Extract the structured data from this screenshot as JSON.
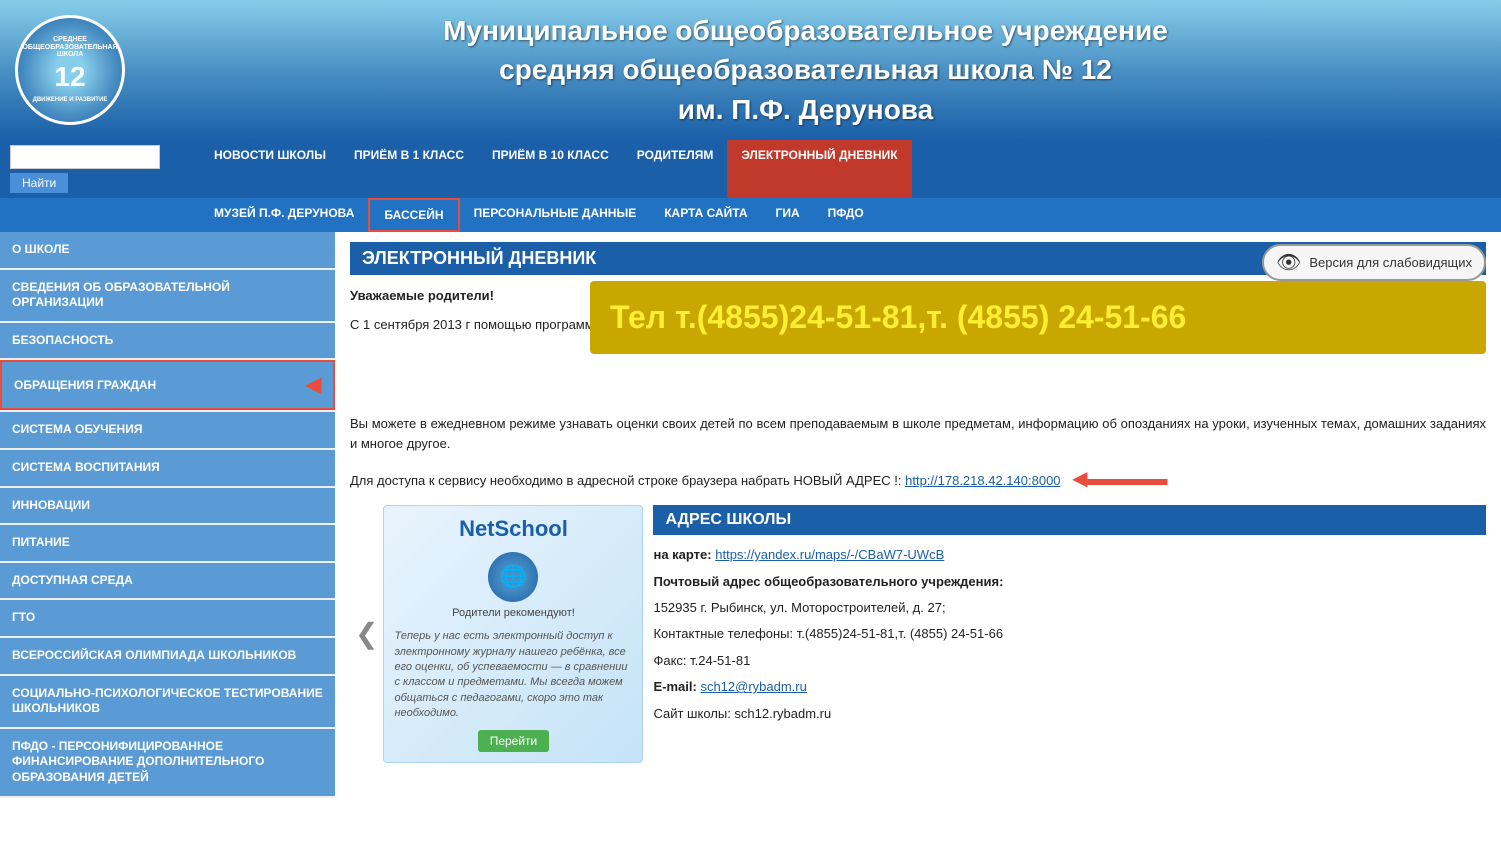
{
  "header": {
    "title_line1": "Муниципальное общеобразовательное  учреждение",
    "title_line2": "средняя общеобразовательная школа № 12",
    "title_line3": "им. П.Ф. Дерунова",
    "logo_number": "12"
  },
  "nav": {
    "search_placeholder": "",
    "search_btn": "Найти",
    "row1": [
      {
        "label": "НОВОСТИ ШКОЛЫ",
        "active": false
      },
      {
        "label": "ПРИЁМ В 1 КЛАСС",
        "active": false
      },
      {
        "label": "ПРИЁМ В 10 КЛАСС",
        "active": false
      },
      {
        "label": "РОДИТЕЛЯМ",
        "active": false
      },
      {
        "label": "ЭЛЕКТРОННЫЙ ДНЕВНИК",
        "active": true
      }
    ],
    "row2": [
      {
        "label": "МУЗЕЙ П.Ф. ДЕРУНОВА",
        "active": false
      },
      {
        "label": "БАССЕЙН",
        "active": false,
        "boxed": true
      },
      {
        "label": "ПЕРСОНАЛЬНЫЕ ДАННЫЕ",
        "active": false
      },
      {
        "label": "КАРТА САЙТА",
        "active": false
      },
      {
        "label": "ГИА",
        "active": false
      },
      {
        "label": "ПФДО",
        "active": false
      }
    ]
  },
  "sidebar": {
    "items": [
      {
        "label": "О ШКОЛЕ"
      },
      {
        "label": "СВЕДЕНИЯ ОБ ОБРАЗОВАТЕЛЬНОЙ ОРГАНИЗАЦИИ"
      },
      {
        "label": "БЕЗОПАСНОСТЬ"
      },
      {
        "label": "ОБРАЩЕНИЯ ГРАЖДАН",
        "active": true
      },
      {
        "label": "СИСТЕМА ОБУЧЕНИЯ"
      },
      {
        "label": "СИСТЕМА ВОСПИТАНИЯ"
      },
      {
        "label": "ИННОВАЦИИ"
      },
      {
        "label": "ПИТАНИЕ"
      },
      {
        "label": "ДОСТУПНАЯ СРЕДА"
      },
      {
        "label": "ГТО"
      },
      {
        "label": "ВСЕРОССИЙСКАЯ ОЛИМПИАДА ШКОЛЬНИКОВ"
      },
      {
        "label": "СОЦИАЛЬНО-ПСИХОЛОГИЧЕСКОЕ ТЕСТИРОВАНИЕ ШКОЛЬНИКОВ"
      },
      {
        "label": "ПФДО - ПЕРСОНИФИЦИРОВАННОЕ ФИНАНСИРОВАНИЕ ДОПОЛНИТЕЛЬНОГО ОБРАЗОВАНИЯ ДЕТЕЙ"
      }
    ]
  },
  "content": {
    "section_title": "ЭЛЕКТРОННЫЙ ДНЕВНИК",
    "vision_btn": "Версия для слабовидящих",
    "phone_banner": "Тел т.(4855)24-51-81,т. (4855) 24-51-66",
    "para1": "Уважаемые родители!",
    "para2_start": "С 1 сентября 2013 г",
    "para2_rest": "помощью программы",
    "para3": "Вы можете в ежедневном режиме узнавать оценки своих детей по всем преподаваемым в школе предметам, информацию об опозданиях на уроки, изученных темах, домашних заданиях и многое другое.",
    "para4_start": "Для доступа к сервису необходимо в адресной строке браузера набрать НОВЫЙ АДРЕС !:",
    "address_link": "http://178.218.42.140:8000",
    "address": {
      "header": "АДРЕС ШКОЛЫ",
      "map_label": "на карте:",
      "map_link_text": "https://yandex.ru/maps/-/CBaW7-UWcB",
      "map_link_url": "https://yandex.ru/maps/-/CBaW7-UWcB",
      "line1": "Почтовый адрес общеобразовательного учреждения:",
      "line2": "152935 г. Рыбинск, ул. Моторостроителей, д. 27;",
      "line3": "Контактные телефоны:  т.(4855)24-51-81,т. (4855) 24-51-66",
      "line4": "Факс: т.24-51-81",
      "line5_label": "E-mail:",
      "line5_email": "sch12@rybadm.ru",
      "line6": "Сайт школы: sch12.rybadm.ru"
    },
    "netschool": {
      "title": "NetSchool",
      "recommend": "Родители рекомендуют!",
      "quote": "Теперь у нас есть электронный доступ к электронному журналу нашего ребёнка, все его оценки, об успеваемости — в сравнении с классом и предметами. Мы всегда можем общаться с педагогами, скоро это так необходимо.",
      "btn": "Перейти"
    }
  }
}
